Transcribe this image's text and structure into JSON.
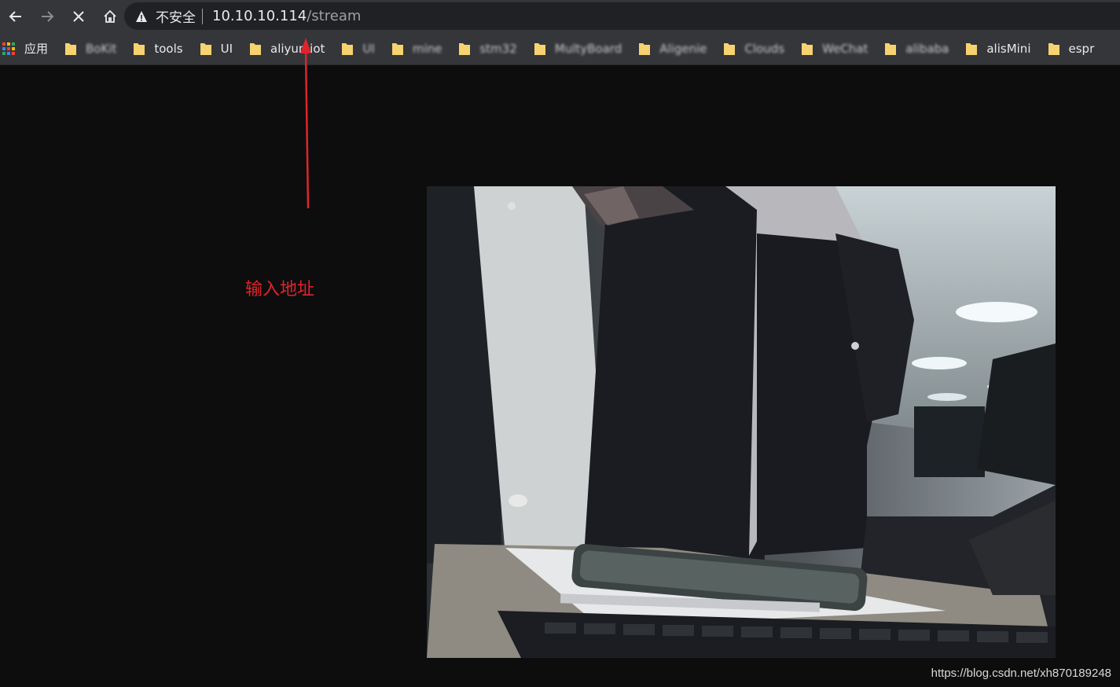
{
  "browser": {
    "insecure_label": "不安全",
    "url_host": "10.10.10.114",
    "url_path": "/stream"
  },
  "bookmarks": {
    "apps_label": "应用",
    "items": [
      {
        "label": "BoKit",
        "blurred": true
      },
      {
        "label": "tools",
        "blurred": false
      },
      {
        "label": "UI",
        "blurred": false
      },
      {
        "label": "aliyun iot",
        "blurred": false
      },
      {
        "label": "UI",
        "blurred": true
      },
      {
        "label": "mine",
        "blurred": true
      },
      {
        "label": "stm32",
        "blurred": true
      },
      {
        "label": "MultyBoard",
        "blurred": true
      },
      {
        "label": "Aligenie",
        "blurred": true
      },
      {
        "label": "Clouds",
        "blurred": true
      },
      {
        "label": "WeChat",
        "blurred": true
      },
      {
        "label": "alibaba",
        "blurred": true
      },
      {
        "label": "alisMini",
        "blurred": false
      },
      {
        "label": "espr",
        "blurred": false
      }
    ]
  },
  "annotation": {
    "text": "输入地址",
    "color": "#e0242b"
  },
  "watermark": "https://blog.csdn.net/xh870189248",
  "colors": {
    "toolbar_bg": "#35363a",
    "omnibox_bg": "#202124",
    "page_bg": "#0d0d0e",
    "folder": "#f6d36f"
  }
}
